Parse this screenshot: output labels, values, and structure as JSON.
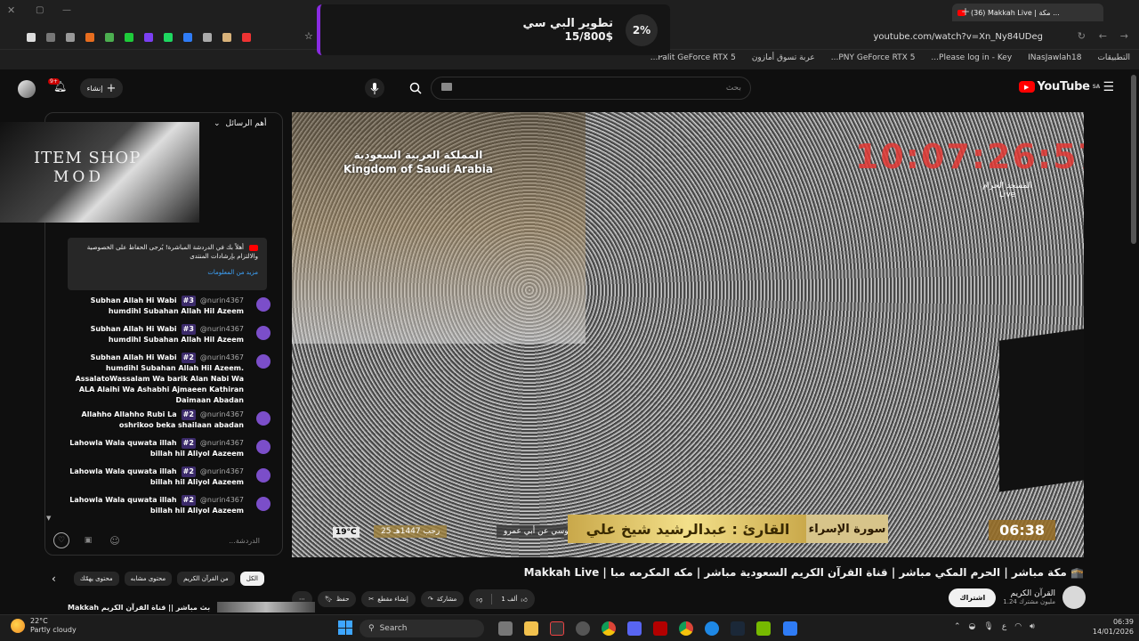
{
  "browser": {
    "tab_title": "(36) Makkah Live | مكة ...",
    "url": "youtube.com/watch?v=Xn_Ny84UDeg",
    "bookmarks": [
      "التطبيقات",
      "INasJawlah18",
      "Please log in - Key...",
      "PNY GeForce RTX 5...",
      "عربة تسوق أمازون",
      "Palit GeForce RTX 5..."
    ]
  },
  "promo": {
    "percent": "2%",
    "title": "تطوير البي سي",
    "amount": "15/800$"
  },
  "youtube": {
    "logo": "YouTube",
    "region": "SA",
    "search_placeholder": "بحث",
    "create_label": "إنشاء",
    "notif_count": "9+"
  },
  "chat": {
    "header": "أهم الرسائل",
    "shop_line1": "ITEM SHOP",
    "shop_line2": "MOD",
    "notice_text": "أهلاً بك في الدردشة المباشرة! يُرجى الحفاظ على الخصوصية والالتزام بإرشادات المنتدى",
    "notice_link": "مزيد من المعلومات",
    "input_placeholder": "الدردشة...",
    "messages": [
      {
        "user": "@nurin4367",
        "badge": "#3",
        "line1": "Subhan Allah Hi Wabi",
        "line2": "humdihl Subahan Allah Hil Azeem"
      },
      {
        "user": "@nurin4367",
        "badge": "#3",
        "line1": "Subhan Allah Hi Wabi",
        "line2": "humdihl Subahan Allah Hil Azeem"
      },
      {
        "user": "@nurin4367",
        "badge": "#2",
        "line1": "Subhan Allah Hi Wabi",
        "line2": "humdihl Subahan Allah Hil Azeem. AssalatoWassalam Wa barik Alan Nabi Wa ALA Alaihi Wa Ashabhi Ajmaeen Kathiran Daimaan Abadan"
      },
      {
        "user": "@nurin4367",
        "badge": "#2",
        "line1": "Allahho Allahho Rubi La",
        "line2": "oshrikoo beka shailaan abadan"
      },
      {
        "user": "@nurin4367",
        "badge": "#2",
        "line1": "Lahowla Wala quwata illah",
        "line2": "billah hil Aliyol Aazeem"
      },
      {
        "user": "@nurin4367",
        "badge": "#2",
        "line1": "Lahowla Wala quwata illah",
        "line2": "billah hil Aliyol Aazeem"
      },
      {
        "user": "@nurin4367",
        "badge": "#2",
        "line1": "Lahowla Wala quwata illah",
        "line2": "billah hil Aliyol Aazeem"
      }
    ]
  },
  "video": {
    "overlay_ksa_ar": "المملكة العربية السعودية",
    "overlay_ksa_en": "Kingdom of Saudi Arabia",
    "clock": "10:07:26:57",
    "live_ar": "المسجد الحرام",
    "live_en": "Live",
    "temperature": "19°C",
    "hijri_date": "25 رجب 1447هـ",
    "riwaya": "رواية السوسي عن أبي عمرو",
    "reader": "القارئ : عبدالرشيد شيخ علي",
    "surah": "سورة الإسراء",
    "time": "06:38"
  },
  "meta": {
    "title": "Makkah Live | مكة مباشر | الحرم المكي مباشر | قناة القرآن الكريم السعودية مباشر | مكه المكرمه مبا 🕋",
    "channel": "القرآن الكريم",
    "subscribers": "1.24 مليون مشترك",
    "subscribe": "اشتراك",
    "likes": "1 ألف",
    "share": "مشاركة",
    "clip": "إنشاء مقطع",
    "save": "حفظ"
  },
  "filters": [
    "الكل",
    "من القرآن الكريم",
    "محتوى مشابه",
    "محتوى يهمّك"
  ],
  "suggest": "Makkah بث مباشر || قناة القرآن الكريم",
  "taskbar": {
    "temp": "22°C",
    "weather": "Partly cloudy",
    "search": "Search",
    "time": "06:39",
    "date": "14/01/2026"
  }
}
